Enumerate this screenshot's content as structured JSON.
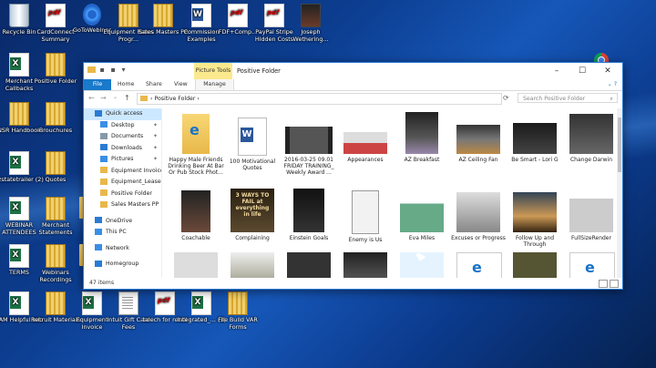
{
  "desktop": {
    "icons": [
      {
        "label": "Recycle Bin",
        "icon": "recycle-bin-icon"
      },
      {
        "label": "CardConnect Summary",
        "icon": "pdf-icon"
      },
      {
        "label": "GoToWebinar",
        "icon": "gotowebinar-icon"
      },
      {
        "label": "Equipment Rates Progr...",
        "icon": "archive-icon"
      },
      {
        "label": "Sales Masters PP",
        "icon": "archive-icon"
      },
      {
        "label": "Commission Examples",
        "icon": "word-icon"
      },
      {
        "label": "FDF+Comp...",
        "icon": "pdf-icon"
      },
      {
        "label": "PayPal Stripe Hidden Costs",
        "icon": "pdf-icon"
      },
      {
        "label": "Joseph Wethering...",
        "icon": "photo-icon"
      },
      {
        "label": "Merchant Callbacks",
        "icon": "excel-icon"
      },
      {
        "label": "Positive Folder",
        "icon": "archive-icon"
      },
      {
        "label": "NSR Handbook",
        "icon": "archive-icon"
      },
      {
        "label": "Brouchures",
        "icon": "archive-icon"
      },
      {
        "label": "azstatetrailer (2)",
        "icon": "excel-icon"
      },
      {
        "label": "Quotes",
        "icon": "archive-icon"
      },
      {
        "label": "WEBINAR ATTENDEES",
        "icon": "excel-icon"
      },
      {
        "label": "Merchant Statements",
        "icon": "archive-icon"
      },
      {
        "label": "Go",
        "icon": "folder-icon"
      },
      {
        "label": "TERMS",
        "icon": "excel-icon"
      },
      {
        "label": "Webinars Recordings",
        "icon": "archive-icon"
      },
      {
        "label": "Lis",
        "icon": "folder-icon"
      },
      {
        "label": "RAM Helpful Info",
        "icon": "excel-icon"
      },
      {
        "label": "Recruit Materials",
        "icon": "archive-icon"
      },
      {
        "label": "Equipment Invoice",
        "icon": "excel-icon"
      },
      {
        "label": "Intuit Gift Card Fees",
        "icon": "document-icon"
      },
      {
        "label": "talech for retail",
        "icon": "pdf-icon"
      },
      {
        "label": "Integrated_... (3)",
        "icon": "excel-icon"
      },
      {
        "label": "File Build VAR Forms",
        "icon": "archive-icon"
      }
    ]
  },
  "explorer": {
    "title": "Positive Folder",
    "context_tab": "Picture Tools",
    "ribbon_tabs": [
      "File",
      "Home",
      "Share",
      "View",
      "Manage"
    ],
    "address": "Positive Folder",
    "search_placeholder": "Search Positive Folder",
    "nav_items": [
      {
        "label": "Quick access",
        "icon": "star-icon",
        "selected": true
      },
      {
        "label": "Desktop",
        "icon": "desktop-icon",
        "pinned": true
      },
      {
        "label": "Documents",
        "icon": "documents-icon",
        "pinned": true
      },
      {
        "label": "Downloads",
        "icon": "downloads-icon",
        "pinned": true
      },
      {
        "label": "Pictures",
        "icon": "pictures-icon",
        "pinned": true
      },
      {
        "label": "Equipment Invoice",
        "icon": "folder-icon"
      },
      {
        "label": "Equipment_Lease R",
        "icon": "folder-icon"
      },
      {
        "label": "Positive Folder",
        "icon": "folder-icon"
      },
      {
        "label": "Sales Masters PP",
        "icon": "folder-icon"
      },
      {
        "label": "OneDrive",
        "icon": "onedrive-icon"
      },
      {
        "label": "This PC",
        "icon": "pc-icon"
      },
      {
        "label": "Network",
        "icon": "network-icon"
      },
      {
        "label": "Homegroup",
        "icon": "homegroup-icon"
      }
    ],
    "files": [
      {
        "label": "Happy Male Friends Drinking Beer At Bar Or Pub Stock Phot...",
        "kind": "edge-html"
      },
      {
        "label": "100 Motivational Quotes",
        "kind": "word"
      },
      {
        "label": "2016-03-25 09.01 FRIDAY TRAINING_ Weekly Award ...",
        "kind": "video"
      },
      {
        "label": "Appearances",
        "kind": "image"
      },
      {
        "label": "AZ Breakfast",
        "kind": "image"
      },
      {
        "label": "AZ Ceiling Fan",
        "kind": "image"
      },
      {
        "label": "Be Smart - Lori G",
        "kind": "image"
      },
      {
        "label": "Change Darwin",
        "kind": "image"
      },
      {
        "label": "Coachable",
        "kind": "image"
      },
      {
        "label": "Complaining",
        "kind": "image"
      },
      {
        "label": "Einstein Goals",
        "kind": "image"
      },
      {
        "label": "Enemy is Us",
        "kind": "image"
      },
      {
        "label": "Eva Miles",
        "kind": "image"
      },
      {
        "label": "Excuses or Progress",
        "kind": "image"
      },
      {
        "label": "Follow Up and Through",
        "kind": "image"
      },
      {
        "label": "FullSizeRender",
        "kind": "image"
      }
    ],
    "thumb_texts": {
      "complaining": "3 WAYS TO FAIL at everything in life"
    },
    "status": "47 items"
  },
  "colors": {
    "accent": "#1979ca",
    "context_tab": "#fbe98e",
    "selected": "#cce8ff"
  }
}
